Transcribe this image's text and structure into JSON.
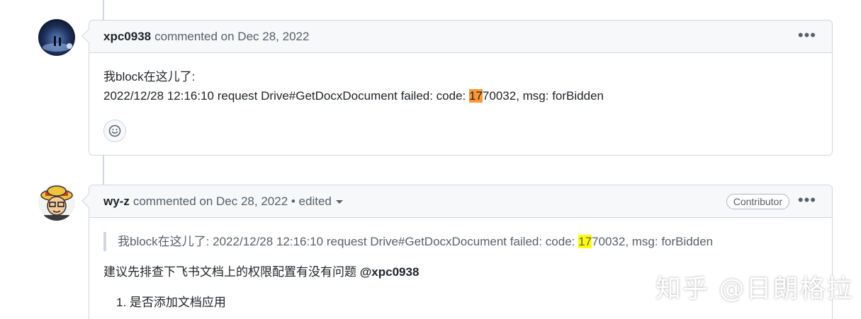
{
  "comments": [
    {
      "author": "xpc0938",
      "meta": "commented on Dec 28, 2022",
      "body_line1": "我block在这儿了:",
      "body_line2_pre": "2022/12/28 12:16:10 request Drive#GetDocxDocument failed: code: ",
      "body_line2_hl": "17",
      "body_line2_post": "70032, msg: forBidden",
      "more_label": "•••"
    },
    {
      "author": "wy-z",
      "meta": "commented on Dec 28, 2022 • edited",
      "badge": "Contributor",
      "quote_pre": "我block在这儿了:  2022/12/28 12:16:10 request Drive#GetDocxDocument failed: code: ",
      "quote_hl": "17",
      "quote_post": "70032, msg: forBidden",
      "paragraph_text": "建议先排查下飞书文档上的权限配置有没有问题 ",
      "mention": "@xpc0938",
      "list_item_1": "1. 是否添加文档应用",
      "more_label": "•••"
    }
  ],
  "watermark": "知乎 @日朗格拉",
  "colors": {
    "highlight_search": "#ff9632",
    "highlight_match": "#ffff00",
    "border": "#d0d7de"
  }
}
